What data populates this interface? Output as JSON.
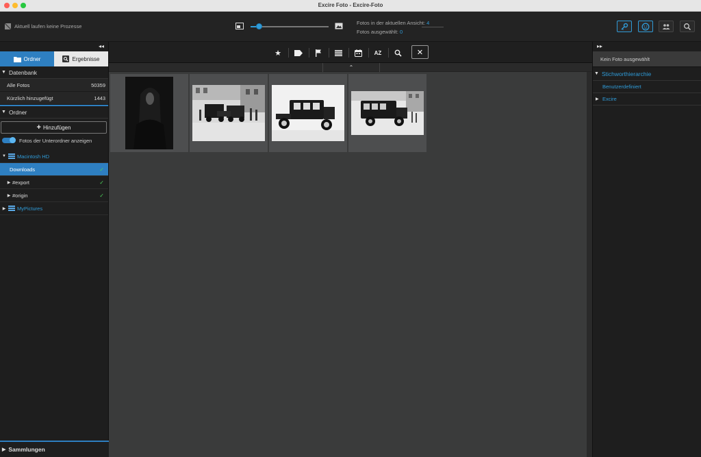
{
  "window": {
    "title": "Excire Foto - Excire-Foto"
  },
  "toolbar": {
    "process_status": "Aktuell laufen keine Prozesse",
    "zoom_slider_value": 0.12,
    "info": {
      "photos_in_view_label": "Fotos in der aktuellen Ansicht:",
      "photos_in_view_value": "4",
      "photos_selected_label": "Fotos ausgewählt:",
      "photos_selected_value": "0"
    },
    "right_buttons": [
      "keyword-search",
      "face-search",
      "people",
      "search"
    ],
    "accent": "#2f9bd8"
  },
  "left": {
    "tabs": [
      {
        "label": "Ordner",
        "active": true
      },
      {
        "label": "Ergebnisse",
        "active": false
      }
    ],
    "database": {
      "title": "Datenbank",
      "rows": [
        {
          "label": "Alle Fotos",
          "count": "50359"
        },
        {
          "label": "Kürzlich hinzugefügt",
          "count": "1443"
        }
      ]
    },
    "folders": {
      "title": "Ordner",
      "add_label": "Hinzufügen",
      "subfolders_label": "Fotos der Unterordner anzeigen",
      "tree": [
        {
          "label": "Macintosh HD"
        },
        {
          "label": "Downloads"
        },
        {
          "label": "#export"
        },
        {
          "label": "#origin"
        },
        {
          "label": "MyPictures"
        }
      ]
    },
    "collections": {
      "title": "Sammlungen"
    }
  },
  "center": {
    "filter_icons": [
      "star-icon",
      "tag-icon",
      "flag-icon",
      "list-icon",
      "calendar-icon",
      "sort-az-icon",
      "search-icon",
      "clear-filter-icon"
    ],
    "sort_label": "AZ",
    "photos": [
      {
        "desc": "portrait"
      },
      {
        "desc": "street-carriages"
      },
      {
        "desc": "car-side"
      },
      {
        "desc": "car-street"
      }
    ]
  },
  "right": {
    "no_photo": "Kein Foto ausgewählt",
    "keyword_title": "Stichworthierarchie",
    "items": [
      {
        "label": "Benutzerdefiniert"
      },
      {
        "label": "Excire"
      }
    ]
  }
}
